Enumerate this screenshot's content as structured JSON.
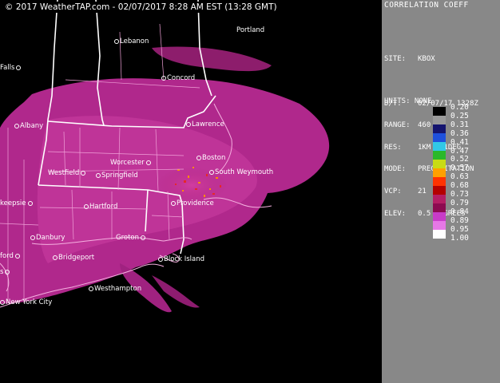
{
  "copyright": "© 2017 WeatherTAP.com - 02/07/2017  8:28 AM EST (13:28 GMT)",
  "panel": {
    "title": "CORRELATION COEFF",
    "meta": [
      {
        "key": "SITE:",
        "value": "KBOX"
      },
      {
        "key": "",
        "value": ""
      },
      {
        "key": "D/T:",
        "value": "02/07/17 1328Z"
      },
      {
        "key": "RANGE:",
        "value": "460 KM"
      },
      {
        "key": "RES:",
        "value": "1KM X 1DEG"
      },
      {
        "key": "MODE:",
        "value": "PRECIPITATION"
      },
      {
        "key": "VCP:",
        "value": "21"
      },
      {
        "key": "ELEV:",
        "value": "0.5 DEGREES"
      }
    ],
    "units_label": "UNITS: NONE",
    "scale_values": [
      "0.20",
      "0.25",
      "0.31",
      "0.36",
      "0.41",
      "0.47",
      "0.52",
      "0.57",
      "0.63",
      "0.68",
      "0.73",
      "0.79",
      "0.84",
      "0.89",
      "0.95",
      "1.00"
    ],
    "scale_colors": [
      "#000000",
      "#9a9a9a",
      "#14146e",
      "#1e50dc",
      "#32c8e6",
      "#2ab82a",
      "#c8dc14",
      "#ffa000",
      "#ff3200",
      "#b40000",
      "#b41e64",
      "#8c0a50",
      "#c83cc8",
      "#e678e6",
      "#ffffff"
    ]
  },
  "cities": [
    {
      "name": "Lebanon"
    },
    {
      "name": "Portland"
    },
    {
      "name": "Falls"
    },
    {
      "name": "Concord"
    },
    {
      "name": "Albany"
    },
    {
      "name": "Lawrence"
    },
    {
      "name": "Worcester"
    },
    {
      "name": "Boston"
    },
    {
      "name": "Westfield"
    },
    {
      "name": "Springfield"
    },
    {
      "name": "South Weymouth"
    },
    {
      "name": "keepsie"
    },
    {
      "name": "Hartford"
    },
    {
      "name": "Providence"
    },
    {
      "name": "Danbury"
    },
    {
      "name": "Groton"
    },
    {
      "name": "Bridgeport"
    },
    {
      "name": "Block Island"
    },
    {
      "name": "ford"
    },
    {
      "name": "s"
    },
    {
      "name": "Westhampton"
    },
    {
      "name": "New York City"
    }
  ]
}
